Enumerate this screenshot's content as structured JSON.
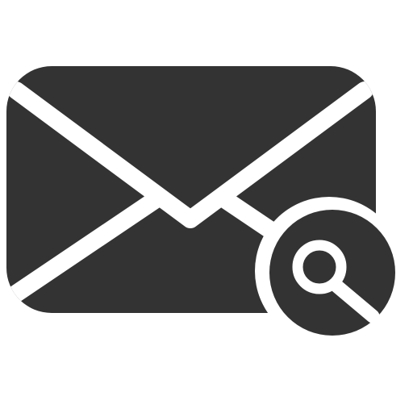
{
  "icon": {
    "name": "mail-search-icon",
    "parts": [
      "envelope-icon",
      "magnifier-icon"
    ]
  },
  "colors": {
    "background": "#ffffff",
    "glyph": "#333333",
    "cutout": "#ffffff"
  }
}
